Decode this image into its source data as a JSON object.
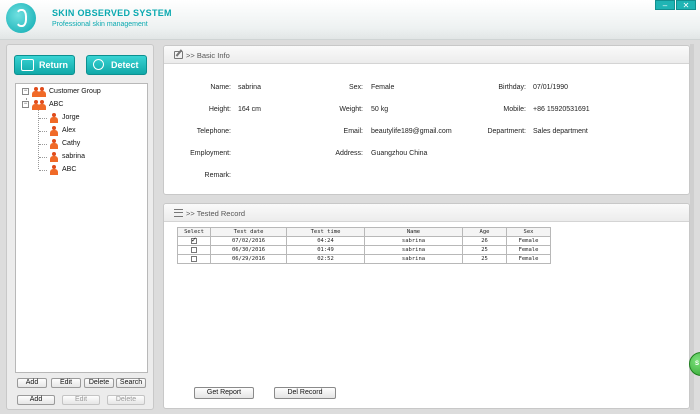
{
  "app": {
    "name_part1": "SKIN",
    "name_part2": " OBSERVED SYSTEM",
    "subtitle": "Professional skin management",
    "min_glyph": "–",
    "close_glyph": "✕"
  },
  "sidebar": {
    "return_label": "Return",
    "detect_label": "Detect",
    "tree": {
      "root": "Customer Group",
      "group": "ABC",
      "members": [
        "Jorge",
        "Alex",
        "Cathy",
        "sabrina",
        "ABC"
      ]
    },
    "buttons_row1": [
      "Add",
      "Edit",
      "Delete",
      "Search"
    ],
    "buttons_row2": [
      "Add",
      "Edit",
      "Delete"
    ]
  },
  "basic_info": {
    "title": ">> Basic Info",
    "fields": {
      "name": {
        "label": "Name:",
        "value": "sabrina"
      },
      "sex": {
        "label": "Sex:",
        "value": "Female"
      },
      "birthday": {
        "label": "Birthday:",
        "value": "07/01/1990"
      },
      "height": {
        "label": "Height:",
        "value": "164 cm"
      },
      "weight": {
        "label": "Weight:",
        "value": "50 kg"
      },
      "mobile": {
        "label": "Mobile:",
        "value": "+86 15920531691"
      },
      "telephone": {
        "label": "Telephone:",
        "value": ""
      },
      "email": {
        "label": "Email:",
        "value": "beautylife189@gmail.com"
      },
      "department": {
        "label": "Department:",
        "value": "Sales department"
      },
      "employment": {
        "label": "Employment:",
        "value": ""
      },
      "address": {
        "label": "Address:",
        "value": "Guangzhou China"
      },
      "remark": {
        "label": "Remark:",
        "value": ""
      }
    }
  },
  "tested_record": {
    "title": ">> Tested Record",
    "columns": [
      "Select",
      "Test date",
      "Test time",
      "Name",
      "Age",
      "Sex"
    ],
    "rows": [
      {
        "selected": true,
        "date": "07/02/2016",
        "time": "04:24",
        "name": "sabrina",
        "age": "26",
        "sex": "Female"
      },
      {
        "selected": false,
        "date": "06/30/2016",
        "time": "01:49",
        "name": "sabrina",
        "age": "25",
        "sex": "Female"
      },
      {
        "selected": false,
        "date": "06/29/2016",
        "time": "02:52",
        "name": "sabrina",
        "age": "25",
        "sex": "Female"
      }
    ],
    "get_report_label": "Get Report",
    "del_record_label": "Del Record"
  },
  "side_badge": "S"
}
